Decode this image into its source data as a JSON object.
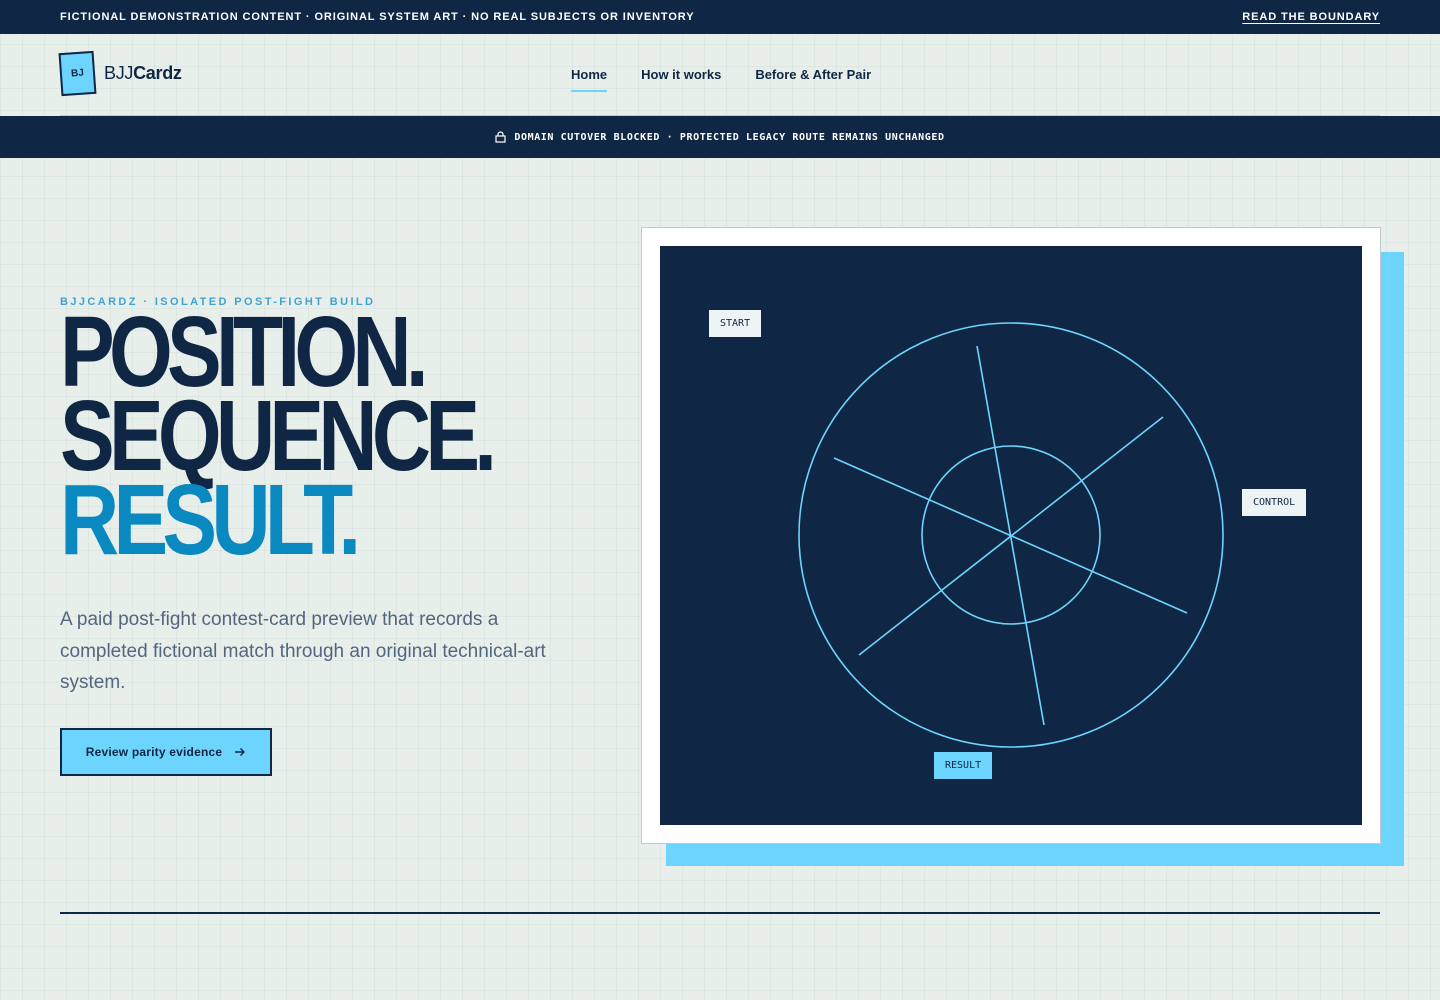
{
  "notice": {
    "text": "FICTIONAL DEMONSTRATION CONTENT · ORIGINAL SYSTEM ART · NO REAL SUBJECTS OR INVENTORY",
    "link": "READ THE BOUNDARY"
  },
  "brand": {
    "mark": "BJ",
    "name_light": "BJJ",
    "name_bold": "Cardz"
  },
  "nav": {
    "items": [
      {
        "label": "Home",
        "active": true
      },
      {
        "label": "How it works",
        "active": false
      },
      {
        "label": "Before & After Pair",
        "active": false
      }
    ]
  },
  "status": {
    "icon": "lock-icon",
    "text": "DOMAIN CUTOVER BLOCKED · PROTECTED LEGACY ROUTE REMAINS UNCHANGED"
  },
  "hero": {
    "eyebrow": "BJJCARDZ · ISOLATED POST-FIGHT BUILD",
    "headline": [
      "POSITION.",
      "SEQUENCE.",
      "RESULT."
    ],
    "lede": "A paid post-fight contest-card preview that records a completed fictional match through an original technical-art system.",
    "cta": {
      "label": "Review parity evidence",
      "icon": "arrow-right-icon"
    }
  },
  "diagram": {
    "labels": {
      "start": "START",
      "control": "CONTROL",
      "result": "RESULT"
    }
  },
  "colors": {
    "navy": "#0f2744",
    "accent": "#6dd5fd",
    "headline_accent": "#0a88c0",
    "eyebrow": "#3ea3d3",
    "background": "#e8efea"
  }
}
